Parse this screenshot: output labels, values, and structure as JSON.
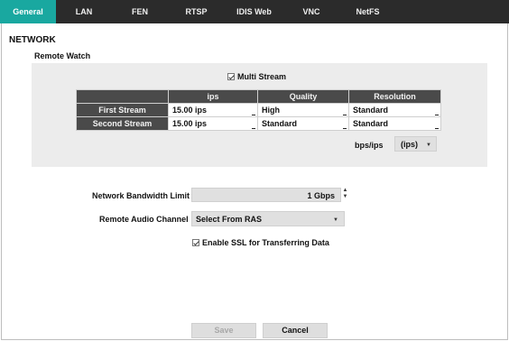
{
  "tabs": [
    {
      "label": "General",
      "active": true
    },
    {
      "label": "LAN"
    },
    {
      "label": "FEN"
    },
    {
      "label": "RTSP"
    },
    {
      "label": "IDIS Web"
    },
    {
      "label": "VNC"
    },
    {
      "label": "NetFS"
    }
  ],
  "section_title": "NETWORK",
  "remote_watch": {
    "title": "Remote Watch",
    "multi_stream_label": "Multi Stream",
    "multi_stream_checked": true,
    "table": {
      "headers": [
        "",
        "ips",
        "Quality",
        "Resolution"
      ],
      "rows": [
        {
          "name": "First Stream",
          "ips": "15.00 ips",
          "quality": "High",
          "resolution": "Standard"
        },
        {
          "name": "Second Stream",
          "ips": "15.00 ips",
          "quality": "Standard",
          "resolution": "Standard"
        }
      ]
    },
    "bps_label": "bps/ips",
    "bps_value": "(ips)"
  },
  "bandwidth": {
    "label": "Network Bandwidth Limit",
    "value": "1 Gbps"
  },
  "audio": {
    "label": "Remote Audio Channel",
    "value": "Select From RAS"
  },
  "ssl": {
    "label": "Enable SSL for Transferring Data",
    "checked": true
  },
  "buttons": {
    "save": "Save",
    "cancel": "Cancel"
  },
  "colors": {
    "accent": "#19a8a0",
    "tabbar": "#2b2b2b",
    "panel": "#ececec",
    "table_header": "#4a4a4a"
  }
}
